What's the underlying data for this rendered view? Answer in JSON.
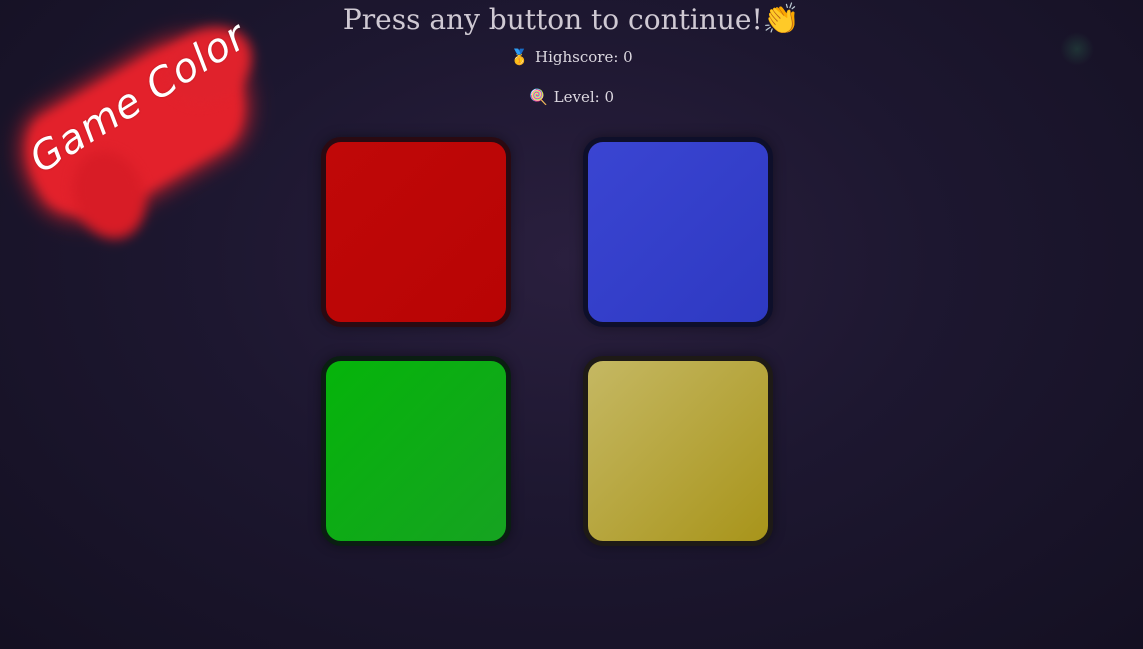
{
  "logo": {
    "text": "Game Color",
    "color": "#e3212b"
  },
  "header": {
    "title": "Press any button to continue!",
    "title_emoji": "👏"
  },
  "stats": {
    "highscore": {
      "icon": "🥇",
      "label": "Highscore: 0"
    },
    "level": {
      "icon": "🍭",
      "label": "Level: 0"
    }
  },
  "pads": [
    {
      "name": "red",
      "color": "#c00808"
    },
    {
      "name": "blue",
      "color": "#3a45d2"
    },
    {
      "name": "green",
      "color": "#05b40a"
    },
    {
      "name": "yellow",
      "color": "#c5b863"
    }
  ],
  "colors": {
    "background": "#1d1730",
    "text": "#d8d4dc"
  }
}
